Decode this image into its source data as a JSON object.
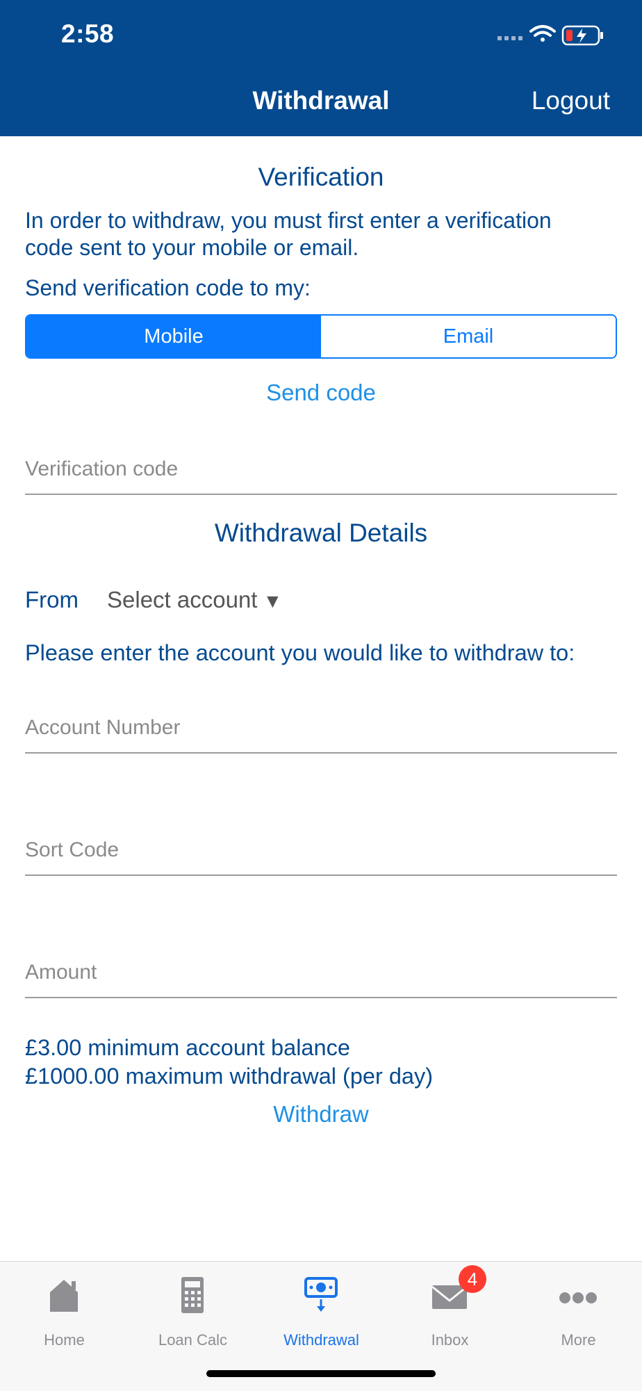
{
  "status_bar": {
    "time": "2:58"
  },
  "nav": {
    "title": "Withdrawal",
    "logout": "Logout"
  },
  "verification": {
    "title": "Verification",
    "intro_line1": "In order to withdraw, you must first enter a verification",
    "intro_line2": "code sent to your mobile or email.",
    "send_to_label": "Send verification code to my:",
    "options": [
      "Mobile",
      "Email"
    ],
    "selected": "Mobile",
    "send_code": "Send code",
    "code_placeholder": "Verification code"
  },
  "details": {
    "title": "Withdrawal Details",
    "from_label": "From",
    "from_select": "Select account",
    "instruction": "Please enter the account you would like to withdraw to:",
    "account_number_placeholder": "Account Number",
    "sort_code_placeholder": "Sort Code",
    "amount_placeholder": "Amount",
    "min_balance": "£3.00 minimum account balance",
    "max_withdrawal": "£1000.00 maximum withdrawal (per day)",
    "withdraw_button": "Withdraw"
  },
  "tabbar": {
    "items": [
      {
        "label": "Home",
        "icon": "home-icon"
      },
      {
        "label": "Loan Calc",
        "icon": "calculator-icon"
      },
      {
        "label": "Withdrawal",
        "icon": "withdrawal-icon"
      },
      {
        "label": "Inbox",
        "icon": "mail-icon"
      },
      {
        "label": "More",
        "icon": "more-icon"
      }
    ],
    "active": "Withdrawal",
    "inbox_badge": "4"
  },
  "colors": {
    "header": "#054a8f",
    "accent": "#0a7aff",
    "link": "#1e90e6",
    "badge": "#ff3b30"
  }
}
